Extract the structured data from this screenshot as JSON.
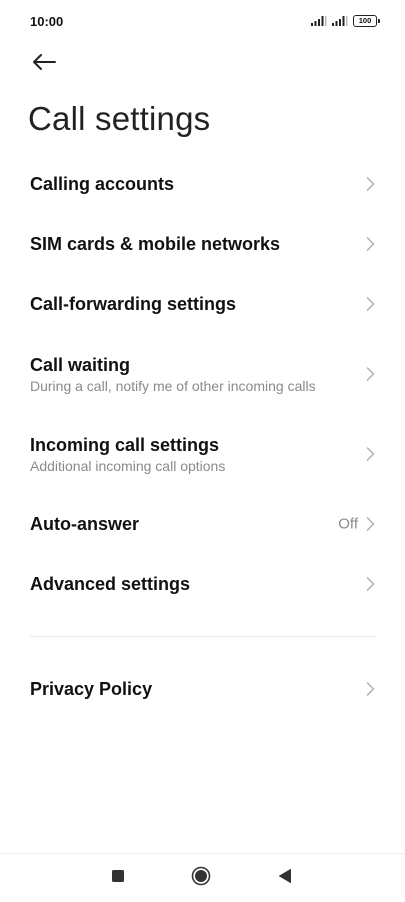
{
  "status": {
    "time": "10:00",
    "battery": "100"
  },
  "header": {
    "title": "Call settings"
  },
  "settings": [
    {
      "label": "Calling accounts",
      "sub": "",
      "value": ""
    },
    {
      "label": "SIM cards & mobile networks",
      "sub": "",
      "value": ""
    },
    {
      "label": "Call-forwarding settings",
      "sub": "",
      "value": ""
    },
    {
      "label": "Call waiting",
      "sub": "During a call, notify me of other incoming calls",
      "value": ""
    },
    {
      "label": "Incoming call settings",
      "sub": "Additional incoming call options",
      "value": ""
    },
    {
      "label": "Auto-answer",
      "sub": "",
      "value": "Off"
    },
    {
      "label": "Advanced settings",
      "sub": "",
      "value": ""
    }
  ],
  "privacy": {
    "label": "Privacy Policy"
  },
  "icons": {
    "back": "back-arrow-icon",
    "chevron": "chevron-right-icon",
    "signal": "signal-icon",
    "nav_recents": "square-icon",
    "nav_home": "circle-icon",
    "nav_back": "triangle-icon"
  }
}
